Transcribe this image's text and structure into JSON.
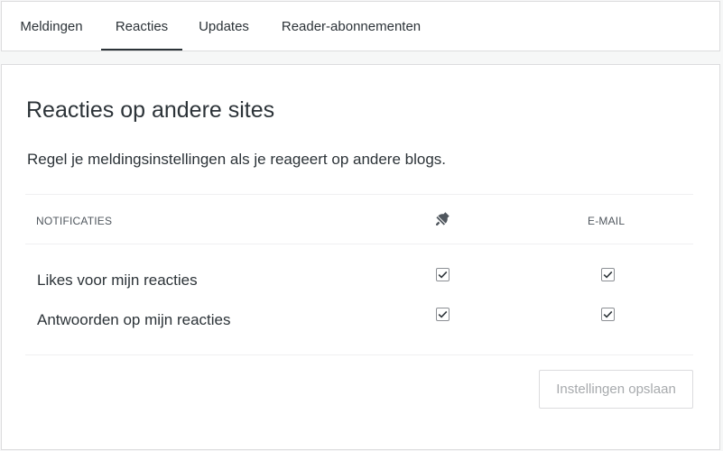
{
  "tabs": [
    {
      "label": "Meldingen",
      "active": false
    },
    {
      "label": "Reacties",
      "active": true
    },
    {
      "label": "Updates",
      "active": false
    },
    {
      "label": "Reader-abonnementen",
      "active": false
    }
  ],
  "section": {
    "title": "Reacties op andere sites",
    "description": "Regel je meldingsinstellingen als je reageert op andere blogs."
  },
  "table": {
    "columns": {
      "notifications": "NOTIFICATIES",
      "push_icon": "bell-icon",
      "email": "E-MAIL"
    },
    "rows": [
      {
        "label": "Likes voor mijn reacties",
        "push": true,
        "email": true
      },
      {
        "label": "Antwoorden op mijn reacties",
        "push": true,
        "email": true
      }
    ]
  },
  "actions": {
    "save_label": "Instellingen opslaan",
    "save_enabled": false
  },
  "colors": {
    "text": "#2c3338",
    "muted": "#50575e",
    "border": "#dcdcde",
    "checkmark": "#2c3338",
    "disabled_text": "#a7aaad"
  }
}
